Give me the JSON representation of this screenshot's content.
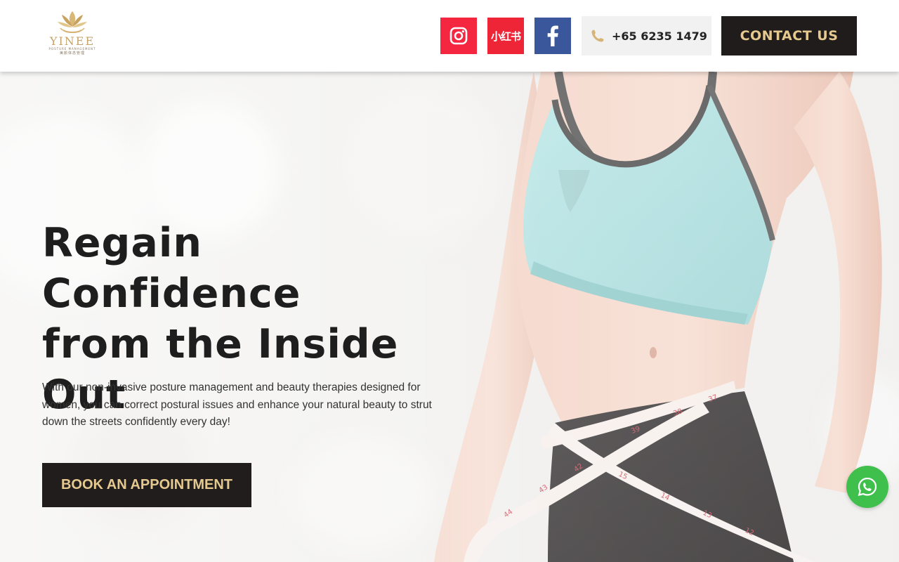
{
  "brand": {
    "name": "YINEE",
    "tagline": "POSTURE MANAGEMENT",
    "chinese": "美颜体态管理"
  },
  "social": [
    {
      "name": "instagram-icon"
    },
    {
      "name": "xiaohongshu-icon",
      "label": "小红书"
    },
    {
      "name": "facebook-icon"
    }
  ],
  "header": {
    "phone": "+65 6235 1479",
    "contact_label": "CONTACT US"
  },
  "hero": {
    "title_line1": "Regain Confidence",
    "title_line2": "from the Inside",
    "title_line3": "Out",
    "description": "With our non-invasive posture management and beauty therapies designed for women, you can correct postural issues and enhance your natural beauty to strut down the streets confidently every day!",
    "cta_label": "BOOK AN APPOINTMENT"
  },
  "colors": {
    "gold": "#e5c98f",
    "dark": "#201c1b",
    "instagram": "#f5263f",
    "xiaohongshu": "#ee2536",
    "facebook": "#39579a",
    "whatsapp": "#3fbf4c"
  }
}
